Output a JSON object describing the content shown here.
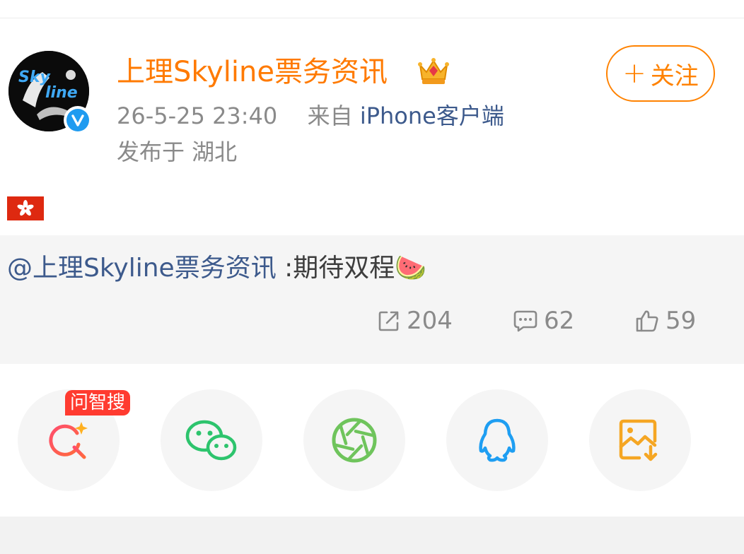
{
  "post": {
    "username": "上理Skyline票务资讯",
    "crown_icon": "crown-icon",
    "timestamp": "26-5-25 23:40",
    "source_prefix": "来自",
    "source": "iPhone客户端",
    "location": "发布于 湖北",
    "follow_label": "关注",
    "flag_icon": "hong-kong-flag-icon"
  },
  "repost": {
    "mention": "@上理Skyline票务资讯",
    "text": " :期待双程🍉",
    "stats": {
      "reposts": "204",
      "comments": "62",
      "likes": "59"
    }
  },
  "share": {
    "badge": "问智搜",
    "items": [
      "ai-search-icon",
      "wechat-icon",
      "moments-icon",
      "qq-icon",
      "save-image-icon"
    ]
  },
  "colors": {
    "username": "#ff7a00",
    "follow": "#ff8200",
    "mention": "#3d5a8c",
    "badge": "#ff3b30",
    "wechat": "#2dc46d",
    "moments": "#6fc45c",
    "qq": "#1e9ef2",
    "save": "#f5a623"
  }
}
